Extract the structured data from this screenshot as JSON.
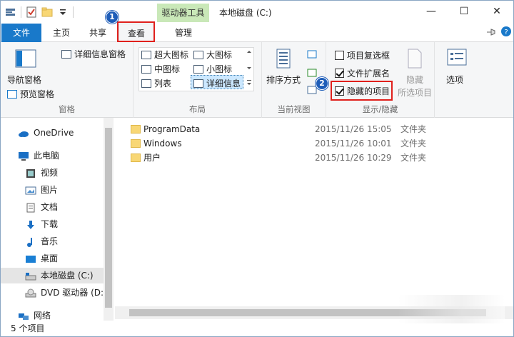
{
  "window": {
    "title": "本地磁盘 (C:)",
    "context_tab": "驱动器工具",
    "minimize": "—",
    "maximize": "☐",
    "close": "✕"
  },
  "tabs": {
    "file": "文件",
    "home": "主页",
    "share": "共享",
    "view": "查看",
    "manage": "管理"
  },
  "ribbon": {
    "pane": {
      "label": "窗格",
      "nav_pane": "导航窗格",
      "preview_pane": "预览窗格",
      "details_pane": "详细信息窗格"
    },
    "layout": {
      "label": "布局",
      "options": [
        "超大图标",
        "大图标",
        "中图标",
        "小图标",
        "列表",
        "详细信息"
      ],
      "selected": "详细信息"
    },
    "current_view": {
      "label": "当前视图",
      "sort": "排序方式"
    },
    "show_hide": {
      "label": "显示/隐藏",
      "item_checkboxes": "项目复选框",
      "file_extensions": "文件扩展名",
      "hidden_items": "隐藏的项目",
      "hide_selected": "隐藏",
      "hide_selected_2": "所选项目",
      "states": {
        "item_checkboxes": false,
        "file_extensions": true,
        "hidden_items": true
      }
    },
    "options": "选项"
  },
  "badges": {
    "one": "1",
    "two": "2"
  },
  "nav": {
    "items": [
      {
        "label": "OneDrive",
        "icon": "cloud-icon"
      },
      {
        "label": "此电脑",
        "icon": "computer-icon"
      },
      {
        "label": "视频",
        "icon": "video-icon"
      },
      {
        "label": "图片",
        "icon": "picture-icon"
      },
      {
        "label": "文档",
        "icon": "document-icon"
      },
      {
        "label": "下载",
        "icon": "download-icon"
      },
      {
        "label": "音乐",
        "icon": "music-icon"
      },
      {
        "label": "桌面",
        "icon": "desktop-icon"
      },
      {
        "label": "本地磁盘 (C:)",
        "icon": "drive-icon"
      },
      {
        "label": "DVD 驱动器 (D:",
        "icon": "dvd-icon"
      },
      {
        "label": "网络",
        "icon": "network-icon"
      }
    ]
  },
  "files": [
    {
      "name": "ProgramData",
      "date": "2015/11/26 15:05",
      "type": "文件夹"
    },
    {
      "name": "Windows",
      "date": "2015/11/26 10:01",
      "type": "文件夹"
    },
    {
      "name": "用户",
      "date": "2015/11/26 10:29",
      "type": "文件夹"
    }
  ],
  "status": {
    "count": "5 个项目"
  },
  "colors": {
    "file_tab": "#1979ca",
    "context_tab": "#c9e8b8",
    "annotation_red": "#e0201c",
    "badge_blue": "#1e5db8"
  }
}
